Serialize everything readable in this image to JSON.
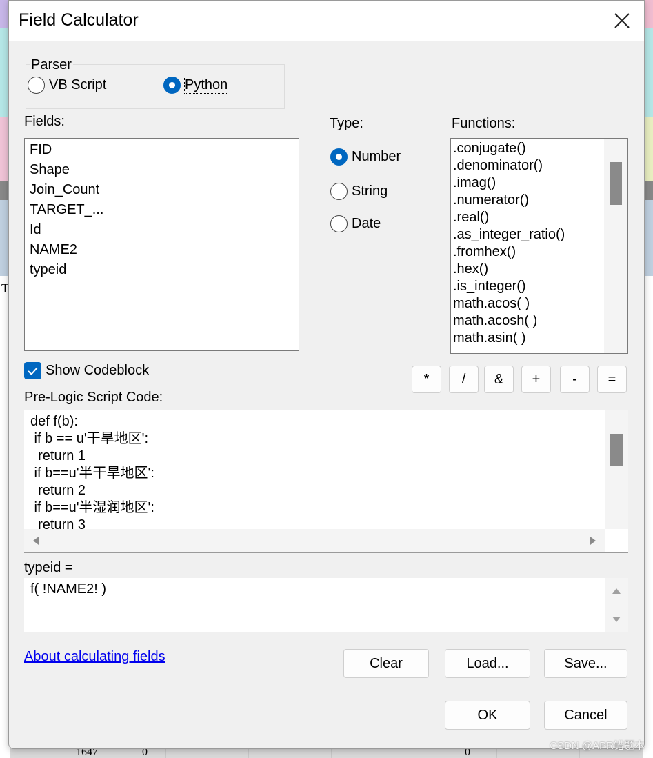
{
  "dialog": {
    "title": "Field Calculator",
    "close_icon": "close-icon"
  },
  "parser": {
    "label": "Parser",
    "options": [
      "VB Script",
      "Python"
    ],
    "selected": "Python"
  },
  "fields": {
    "label": "Fields:",
    "items": [
      "FID",
      "Shape",
      "Join_Count",
      "TARGET_...",
      "Id",
      "NAME2",
      "typeid"
    ]
  },
  "type": {
    "label": "Type:",
    "options": [
      "Number",
      "String",
      "Date"
    ],
    "selected": "Number"
  },
  "functions": {
    "label": "Functions:",
    "items": [
      ".conjugate()",
      ".denominator()",
      ".imag()",
      ".numerator()",
      ".real()",
      ".as_integer_ratio()",
      ".fromhex()",
      ".hex()",
      ".is_integer()",
      "math.acos( )",
      "math.acosh( )",
      "math.asin( )"
    ]
  },
  "codeblock": {
    "show_label": "Show Codeblock",
    "checked": true,
    "pre_logic_label": "Pre-Logic Script Code:",
    "lines": [
      "def f(b):",
      " if b == u'干旱地区':",
      "  return 1",
      " if b==u'半干旱地区':",
      "  return 2",
      " if b==u'半湿润地区':",
      "  return 3"
    ]
  },
  "operators": [
    "*",
    "/",
    "&",
    "+",
    "-",
    "="
  ],
  "expression": {
    "label": "typeid =",
    "value": "f( !NAME2! )"
  },
  "help_link": "About calculating fields",
  "buttons": {
    "clear": "Clear",
    "load": "Load...",
    "save": "Save...",
    "ok": "OK",
    "cancel": "Cancel"
  },
  "watermark": "CSDN @APR错题本",
  "background_cells": [
    "1647",
    "0",
    "0",
    "T"
  ],
  "colors": {
    "accent": "#0067c0",
    "link": "#0000ee"
  }
}
